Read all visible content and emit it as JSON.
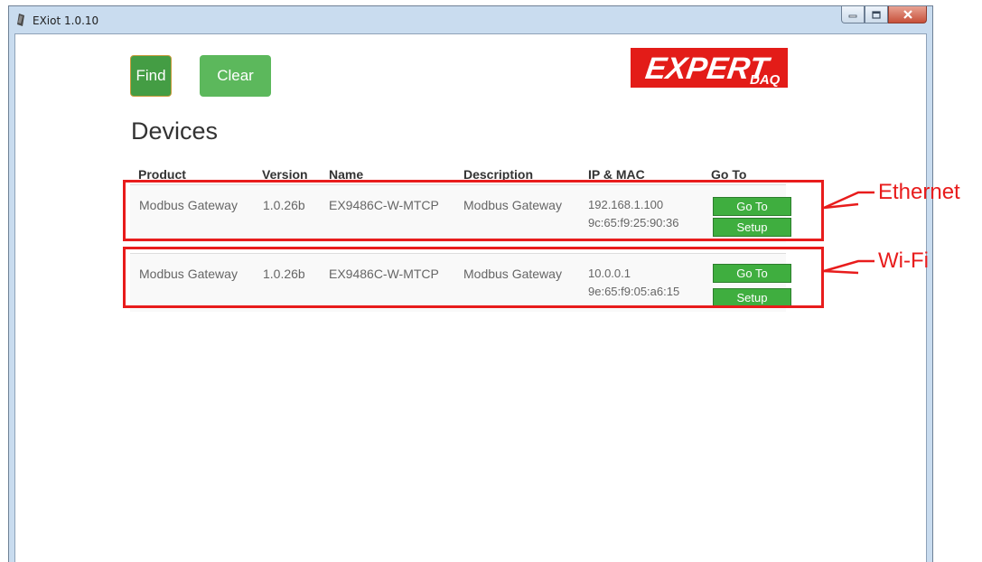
{
  "window": {
    "title": "EXiot 1.0.10"
  },
  "toolbar": {
    "find_label": "Find",
    "clear_label": "Clear"
  },
  "logo": {
    "main": "EXPERT",
    "sub": "DAQ",
    "color": "#e31c18"
  },
  "page_title": "Devices",
  "table": {
    "headers": [
      "Product",
      "Version",
      "Name",
      "Description",
      "IP & MAC",
      "Go To"
    ],
    "rows": [
      {
        "product": "Modbus Gateway",
        "version": "1.0.26b",
        "name": "EX9486C-W-MTCP",
        "description": "Modbus Gateway",
        "ip": "192.168.1.100",
        "mac": "9c:65:f9:25:90:36",
        "goto_label": "Go To",
        "setup_label": "Setup"
      },
      {
        "product": "Modbus Gateway",
        "version": "1.0.26b",
        "name": "EX9486C-W-MTCP",
        "description": "Modbus Gateway",
        "ip": "10.0.0.1",
        "mac": "9e:65:f9:05:a6:15",
        "goto_label": "Go To",
        "setup_label": "Setup"
      }
    ]
  },
  "annotations": [
    {
      "label": "Ethernet",
      "color": "#e81c1c"
    },
    {
      "label": "Wi-Fi",
      "color": "#e81c1c"
    }
  ]
}
